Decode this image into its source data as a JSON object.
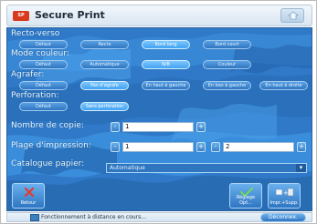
{
  "app": {
    "title": "Secure Print"
  },
  "sections": {
    "duplex": {
      "label": "Recto-verso",
      "options": [
        "Défaut",
        "Recto",
        "Bord long",
        "Bord court"
      ],
      "selected": "Bord long"
    },
    "color": {
      "label": "Mode couleur:",
      "options": [
        "Défaut",
        "Automatique",
        "N/B",
        "Couleur"
      ],
      "selected": "N/B"
    },
    "staple": {
      "label": "Agrafer:",
      "options": [
        "Défaut",
        "Pas d'agrafe",
        "En haut à gauche",
        "En bas à gauche",
        "En haut à droite"
      ],
      "selected": "Pas d'agrafe"
    },
    "punch": {
      "label": "Perforation:",
      "options": [
        "Défaut",
        "Sans perforation"
      ],
      "selected": "Sans perforation"
    }
  },
  "fields": {
    "copies": {
      "label": "Nombre de copie:",
      "value": "1"
    },
    "range": {
      "label": "Plage d'impression:",
      "from": "1",
      "to": "2"
    },
    "catalog": {
      "label": "Catalogue papier:",
      "value": "Automatique"
    }
  },
  "buttons": {
    "back": "Retour",
    "settings": "Réglage Opt...",
    "print_delete": "Impr.+Supp."
  },
  "status": {
    "text": "Fonctionnement à distance en cours...",
    "disconnect": "Déconnex."
  },
  "colors": {
    "panel": "#2f79c8",
    "selected": "#41a2f2",
    "logo": "#d83a1d"
  }
}
